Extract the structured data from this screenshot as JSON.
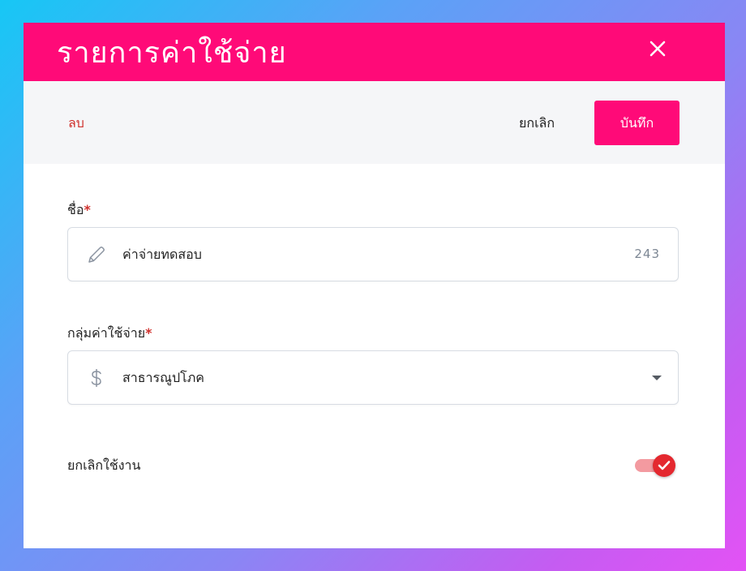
{
  "modal": {
    "title": "รายการค่าใช้จ่าย"
  },
  "toolbar": {
    "delete_label": "ลบ",
    "cancel_label": "ยกเลิก",
    "save_label": "บันทึก"
  },
  "form": {
    "name": {
      "label": "ชื่อ",
      "required_mark": "*",
      "value": "ค่าจ่ายทดสอบ",
      "char_count": "243",
      "icon": "pencil-icon"
    },
    "group": {
      "label": "กลุ่มค่าใช้จ่าย",
      "required_mark": "*",
      "selected_value": "สาธารณูปโภค",
      "icon": "dollar-icon"
    },
    "disable": {
      "label": "ยกเลิกใช้งาน",
      "checked": true
    }
  },
  "colors": {
    "brand": "#ff0a78",
    "danger": "#d0312d",
    "toggle_on": "#e4282f"
  }
}
